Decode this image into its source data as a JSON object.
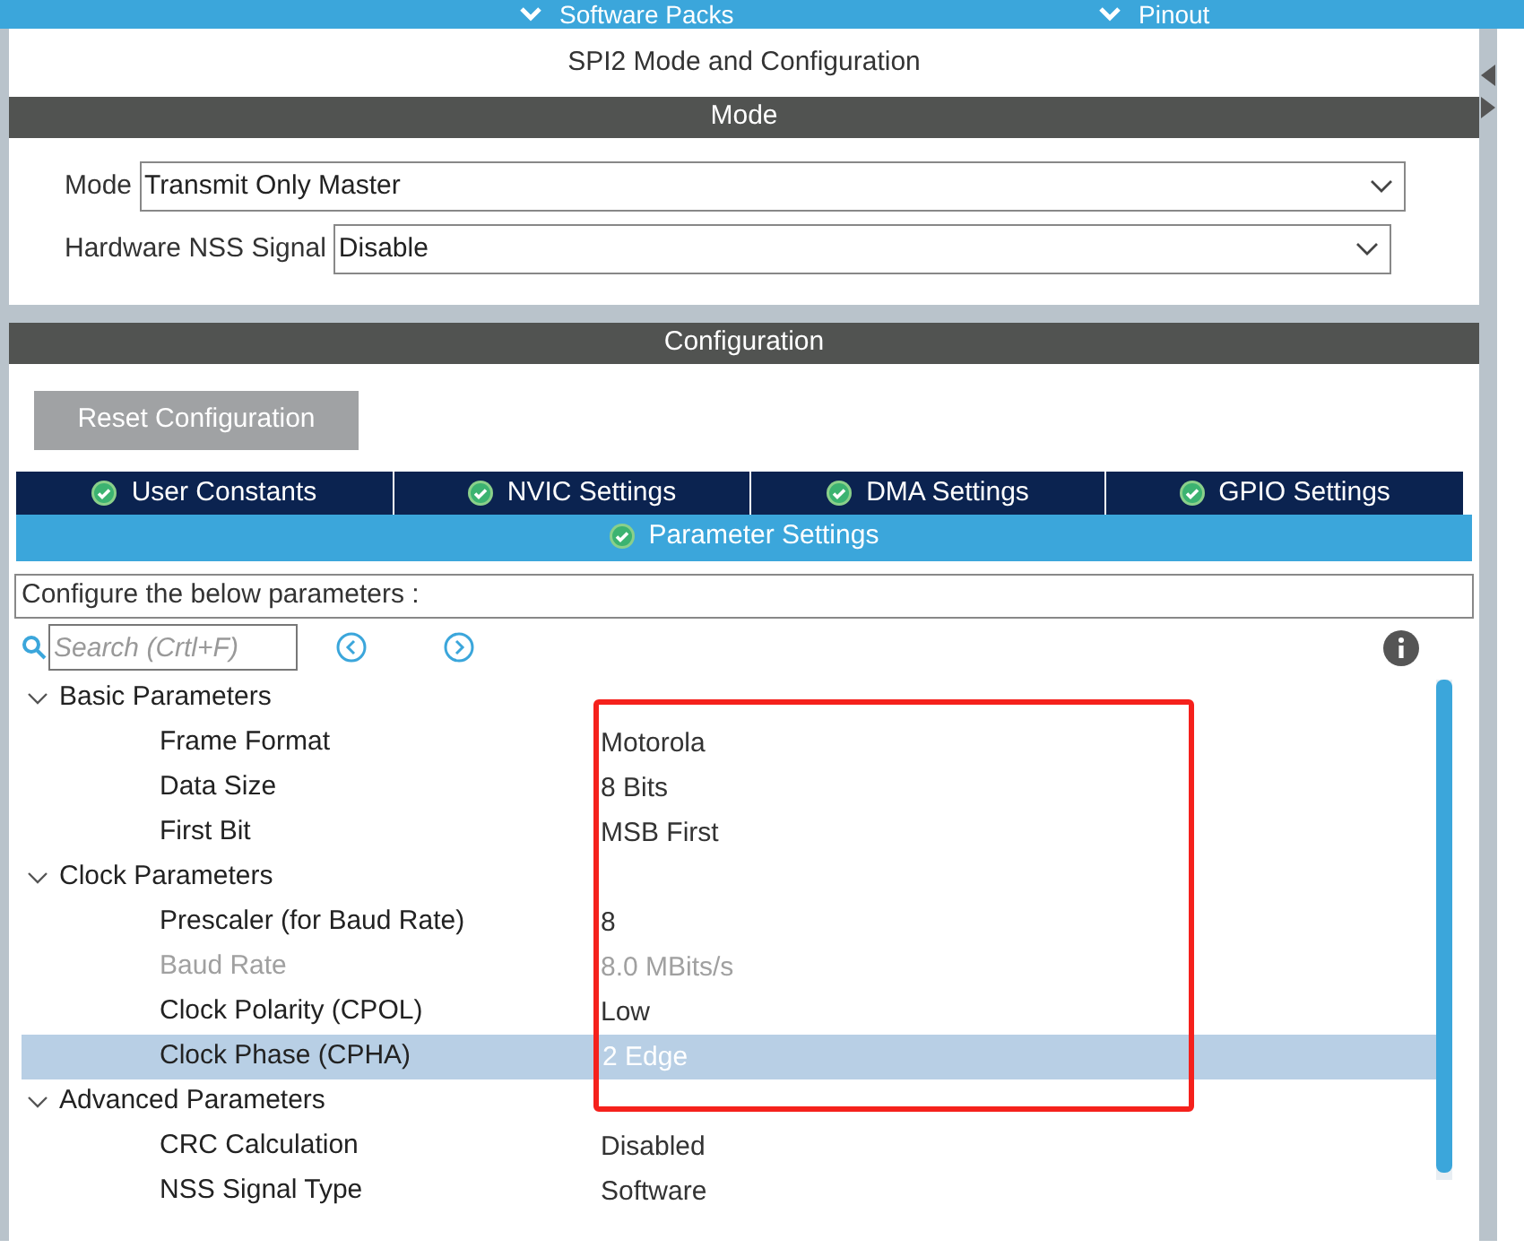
{
  "top_bar": {
    "items": [
      {
        "label": "Software Packs"
      },
      {
        "label": "Pinout"
      }
    ]
  },
  "panel_title": "SPI2 Mode and Configuration",
  "mode_section": {
    "header": "Mode",
    "fields": [
      {
        "label": "Mode",
        "value": "Transmit Only Master"
      },
      {
        "label": "Hardware NSS Signal",
        "value": "Disable"
      }
    ]
  },
  "configuration": {
    "header": "Configuration",
    "reset_button": "Reset Configuration",
    "tabs": [
      {
        "label": "User Constants",
        "selected": false
      },
      {
        "label": "NVIC Settings",
        "selected": false
      },
      {
        "label": "DMA Settings",
        "selected": false
      },
      {
        "label": "GPIO Settings",
        "selected": false
      },
      {
        "label": "Parameter Settings",
        "selected": true
      }
    ],
    "hint": "Configure the below parameters :",
    "search": {
      "placeholder": "Search (Crtl+F)"
    },
    "tree": [
      {
        "label": "Basic Parameters",
        "expanded": true,
        "children": [
          {
            "label": "Frame Format",
            "value": "Motorola",
            "disabled": false,
            "selected": false
          },
          {
            "label": "Data Size",
            "value": "8 Bits",
            "disabled": false,
            "selected": false
          },
          {
            "label": "First Bit",
            "value": "MSB First",
            "disabled": false,
            "selected": false
          }
        ]
      },
      {
        "label": "Clock Parameters",
        "expanded": true,
        "children": [
          {
            "label": "Prescaler (for Baud Rate)",
            "value": "8",
            "disabled": false,
            "selected": false
          },
          {
            "label": "Baud Rate",
            "value": "8.0 MBits/s",
            "disabled": true,
            "selected": false
          },
          {
            "label": "Clock Polarity (CPOL)",
            "value": "Low",
            "disabled": false,
            "selected": false
          },
          {
            "label": "Clock Phase (CPHA)",
            "value": "2 Edge",
            "disabled": false,
            "selected": true
          }
        ]
      },
      {
        "label": "Advanced Parameters",
        "expanded": true,
        "children": [
          {
            "label": "CRC Calculation",
            "value": "Disabled",
            "disabled": false,
            "selected": false
          },
          {
            "label": "NSS Signal Type",
            "value": "Software",
            "disabled": false,
            "selected": false
          }
        ]
      }
    ]
  }
}
